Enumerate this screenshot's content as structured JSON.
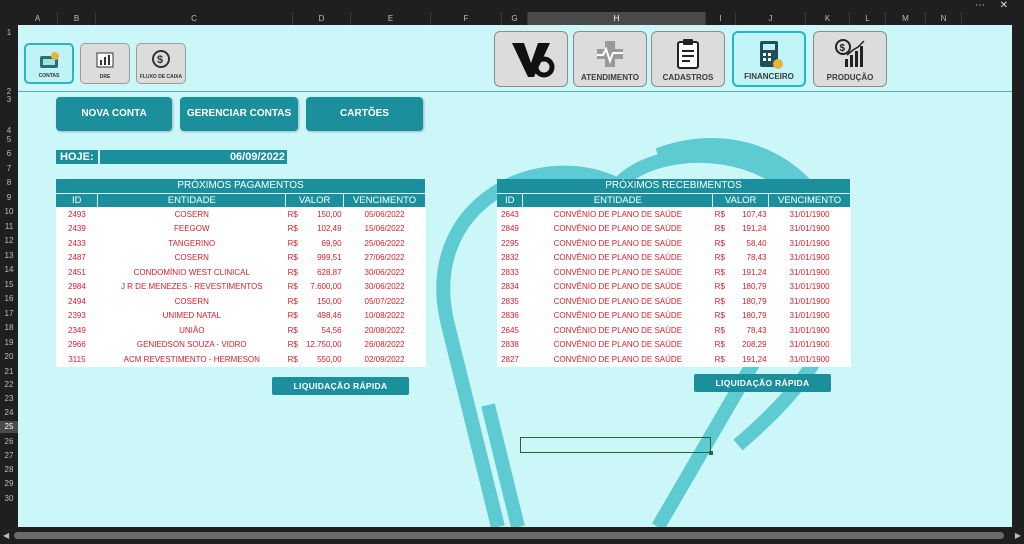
{
  "window": {
    "controls": "⋯  ✕"
  },
  "columns": [
    {
      "label": "A",
      "selected": false
    },
    {
      "label": "B",
      "selected": false
    },
    {
      "label": "C",
      "selected": false
    },
    {
      "label": "D",
      "selected": false
    },
    {
      "label": "E",
      "selected": false
    },
    {
      "label": "F",
      "selected": false
    },
    {
      "label": "G",
      "selected": false
    },
    {
      "label": "H",
      "selected": true
    },
    {
      "label": "I",
      "selected": false
    },
    {
      "label": "J",
      "selected": false
    },
    {
      "label": "K",
      "selected": false
    },
    {
      "label": "L",
      "selected": false
    },
    {
      "label": "M",
      "selected": false
    },
    {
      "label": "N",
      "selected": false
    }
  ],
  "rows": [
    "1",
    "2",
    "3",
    "4",
    "5",
    "6",
    "7",
    "8",
    "9",
    "10",
    "11",
    "12",
    "13",
    "14",
    "15",
    "16",
    "17",
    "18",
    "19",
    "20",
    "21",
    "22",
    "23",
    "24",
    "25",
    "26",
    "27",
    "28",
    "29",
    "30"
  ],
  "selected_row": "25",
  "small_nav": [
    {
      "label": "CONTAS",
      "icon": "accounts-icon",
      "active": true
    },
    {
      "label": "DRE",
      "icon": "dre-icon",
      "active": false
    },
    {
      "label": "FLUXO DE CAIXA",
      "icon": "cash-flow-icon",
      "active": false
    }
  ],
  "main_nav": [
    {
      "label": "",
      "icon": "logo-icon",
      "active": false
    },
    {
      "label": "ATENDIMENTO",
      "icon": "medical-cross-icon",
      "active": false
    },
    {
      "label": "CADASTROS",
      "icon": "clipboard-icon",
      "active": false
    },
    {
      "label": "FINANCEIRO",
      "icon": "calculator-icon",
      "active": true
    },
    {
      "label": "PRODUÇÃO",
      "icon": "growth-chart-icon",
      "active": false
    }
  ],
  "actions": {
    "nova_conta": "NOVA CONTA",
    "gerenciar_contas": "GERENCIAR CONTAS",
    "cartoes": "CARTÕES"
  },
  "hoje": {
    "label": "HOJE:",
    "value": "06/09/2022"
  },
  "colors": {
    "accent": "#1c8f9c",
    "sheet_bg": "#ccf7f8",
    "value_text": "#d6202a"
  },
  "pagamentos": {
    "title": "PRÓXIMOS PAGAMENTOS",
    "headers": [
      "ID",
      "ENTIDADE",
      "VALOR",
      "VENCIMENTO"
    ],
    "currency": "R$",
    "rows": [
      {
        "id": "2493",
        "entidade": "COSERN",
        "valor": "150,00",
        "venc": "05/06/2022"
      },
      {
        "id": "2439",
        "entidade": "FEEGOW",
        "valor": "102,49",
        "venc": "15/06/2022"
      },
      {
        "id": "2433",
        "entidade": "TANGERINO",
        "valor": "69,90",
        "venc": "25/06/2022"
      },
      {
        "id": "2487",
        "entidade": "COSERN",
        "valor": "999,51",
        "venc": "27/06/2022"
      },
      {
        "id": "2451",
        "entidade": "CONDOMÍNIO WEST CLINICAL",
        "valor": "628,87",
        "venc": "30/06/2022"
      },
      {
        "id": "2984",
        "entidade": "J R DE MENEZES - REVESTIMENTOS",
        "valor": "7.600,00",
        "venc": "30/06/2022"
      },
      {
        "id": "2494",
        "entidade": "COSERN",
        "valor": "150,00",
        "venc": "05/07/2022"
      },
      {
        "id": "2393",
        "entidade": "UNIMED NATAL",
        "valor": "498,46",
        "venc": "10/08/2022"
      },
      {
        "id": "2349",
        "entidade": "UNIÃO",
        "valor": "54,56",
        "venc": "20/08/2022"
      },
      {
        "id": "2966",
        "entidade": "GENIEDSON SOUZA - VIDRO",
        "valor": "12.750,00",
        "venc": "26/08/2022"
      },
      {
        "id": "3115",
        "entidade": "ACM REVESTIMENTO - HERMESON",
        "valor": "550,00",
        "venc": "02/09/2022"
      }
    ],
    "button": "LIQUIDAÇÃO RÁPIDA"
  },
  "recebimentos": {
    "title": "PRÓXIMOS RECEBIMENTOS",
    "headers": [
      "ID",
      "ENTIDADE",
      "VALOR",
      "VENCIMENTO"
    ],
    "currency": "R$",
    "rows": [
      {
        "id": "2643",
        "entidade": "CONVÊNIO DE PLANO DE SAÚDE",
        "valor": "107,43",
        "venc": "31/01/1900"
      },
      {
        "id": "2849",
        "entidade": "CONVÊNIO DE PLANO DE SAÚDE",
        "valor": "191,24",
        "venc": "31/01/1900"
      },
      {
        "id": "2295",
        "entidade": "CONVÊNIO DE PLANO DE SAÚDE",
        "valor": "58,40",
        "venc": "31/01/1900"
      },
      {
        "id": "2832",
        "entidade": "CONVÊNIO DE PLANO DE SAÚDE",
        "valor": "78,43",
        "venc": "31/01/1900"
      },
      {
        "id": "2833",
        "entidade": "CONVÊNIO DE PLANO DE SAÚDE",
        "valor": "191,24",
        "venc": "31/01/1900"
      },
      {
        "id": "2834",
        "entidade": "CONVÊNIO DE PLANO DE SAÚDE",
        "valor": "180,79",
        "venc": "31/01/1900"
      },
      {
        "id": "2835",
        "entidade": "CONVÊNIO DE PLANO DE SAÚDE",
        "valor": "180,79",
        "venc": "31/01/1900"
      },
      {
        "id": "2836",
        "entidade": "CONVÊNIO DE PLANO DE SAÚDE",
        "valor": "180,79",
        "venc": "31/01/1900"
      },
      {
        "id": "2645",
        "entidade": "CONVÊNIO DE PLANO DE SAÚDE",
        "valor": "78,43",
        "venc": "31/01/1900"
      },
      {
        "id": "2838",
        "entidade": "CONVÊNIO DE PLANO DE SAÚDE",
        "valor": "208,29",
        "venc": "31/01/1900"
      },
      {
        "id": "2827",
        "entidade": "CONVÊNIO DE PLANO DE SAÚDE",
        "valor": "191,24",
        "venc": "31/01/1900"
      }
    ],
    "button": "LIQUIDAÇÃO RÁPIDA"
  }
}
